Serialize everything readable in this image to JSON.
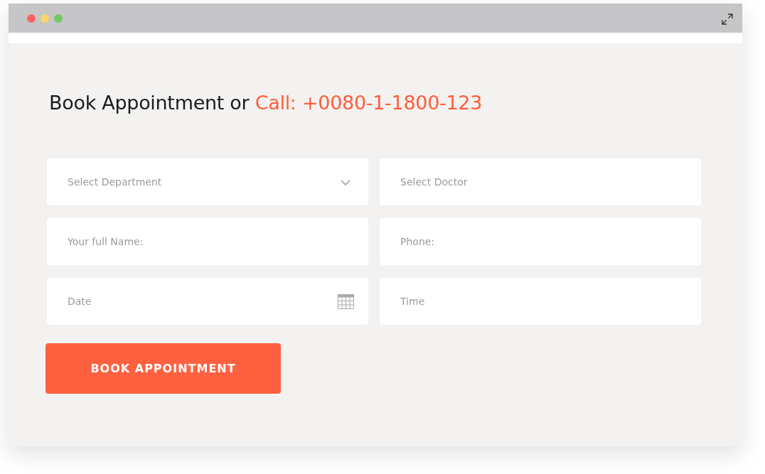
{
  "heading": {
    "text": "Book Appointment or ",
    "highlight": "Call: +0080-1-1800-123"
  },
  "fields": [
    {
      "kind": "select",
      "placeholder": "Select Department"
    },
    {
      "kind": "text",
      "placeholder": "Select Doctor"
    },
    {
      "kind": "text",
      "placeholder": "Your full Name:"
    },
    {
      "kind": "text",
      "placeholder": "Phone:"
    },
    {
      "kind": "date",
      "placeholder": "Date"
    },
    {
      "kind": "text",
      "placeholder": "Time"
    }
  ],
  "submit": {
    "label": "BOOK APPOINTMENT"
  }
}
